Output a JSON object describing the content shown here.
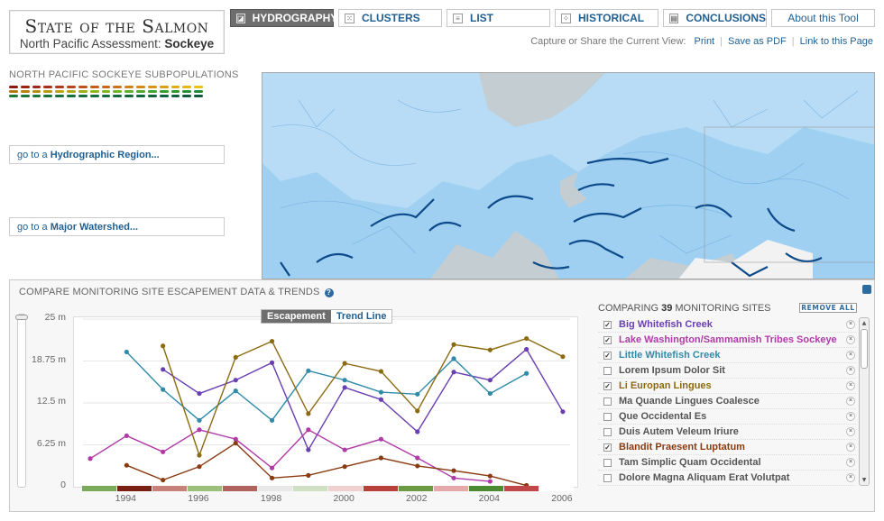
{
  "logo": {
    "title": "State of the Salmon",
    "subtitle_prefix": "North Pacific Assessment: ",
    "subtitle_species": "Sockeye"
  },
  "nav": [
    {
      "label": "HYDROGRAPHY",
      "icon": "hydrography-icon",
      "active": true
    },
    {
      "label": "CLUSTERS",
      "icon": "clusters-icon",
      "active": false
    },
    {
      "label": "LIST",
      "icon": "list-icon",
      "active": false
    },
    {
      "label": "HISTORICAL",
      "icon": "historical-icon",
      "active": false
    },
    {
      "label": "CONCLUSIONS",
      "icon": "conclusions-icon",
      "active": false
    },
    {
      "label": "About this Tool",
      "active": false
    }
  ],
  "share": {
    "prefix": "Capture or Share the Current View:",
    "print": "Print",
    "pdf": "Save as PDF",
    "link": "Link to this Page"
  },
  "left": {
    "subpop_title": "NORTH PACIFIC SOCKEYE SUBPOPULATIONS",
    "goto_region_prefix": "go to a ",
    "goto_region": "Hydrographic Region...",
    "goto_watershed_prefix": "go to a ",
    "goto_watershed": "Major Watershed..."
  },
  "panel": {
    "title": "COMPARE MONITORING SITE ESCAPEMENT DATA & TRENDS",
    "help": "?",
    "toggle_on": "Escapement",
    "toggle_off": "Trend Line",
    "compare_prefix": "COMPARING ",
    "compare_count": "39",
    "compare_suffix": " MONITORING SITES",
    "remove_all": "REMOVE ALL"
  },
  "sites": [
    {
      "name": "Big Whitefish Creek",
      "checked": true,
      "color": "#6a3fb2"
    },
    {
      "name": "Lake Washington/Sammamish Tribes Sockeye",
      "checked": true,
      "color": "#b03aa8"
    },
    {
      "name": "Little Whitefish Creek",
      "checked": true,
      "color": "#2f8ba8"
    },
    {
      "name": "Lorem Ipsum Dolor Sit",
      "checked": false,
      "color": "#555555"
    },
    {
      "name": "Li Europan Lingues",
      "checked": true,
      "color": "#8c6a10"
    },
    {
      "name": "Ma Quande Lingues Coalesce",
      "checked": false,
      "color": "#555555"
    },
    {
      "name": "Que Occidental Es",
      "checked": false,
      "color": "#555555"
    },
    {
      "name": "Duis Autem Veleum Iriure",
      "checked": false,
      "color": "#555555"
    },
    {
      "name": "Blandit Praesent Luptatum",
      "checked": true,
      "color": "#8a3a10"
    },
    {
      "name": "Tam Simplic Quam Occidental",
      "checked": false,
      "color": "#555555"
    },
    {
      "name": "Dolore Magna Aliquam Erat Volutpat",
      "checked": false,
      "color": "#555555"
    }
  ],
  "chart_data": {
    "type": "line",
    "x": [
      1993,
      1994,
      1995,
      1996,
      1997,
      1998,
      1999,
      2000,
      2001,
      2002,
      2003,
      2004,
      2005,
      2006
    ],
    "ylim": [
      0,
      25
    ],
    "yticks": [
      "0",
      "6.25 m",
      "12.5 m",
      "18.75 m",
      "25 m"
    ],
    "xticks": [
      "1994",
      "1996",
      "1998",
      "2000",
      "2002",
      "2004",
      "2006"
    ],
    "series": [
      {
        "name": "Big Whitefish Creek",
        "color": "#6a3fb2",
        "values": [
          null,
          null,
          17.5,
          13.9,
          15.9,
          18.5,
          5.5,
          14.8,
          13.0,
          8.2,
          17.1,
          15.9,
          20.5,
          11.2
        ]
      },
      {
        "name": "Lake Washington/Sammamish Tribes Sockeye",
        "color": "#b03aa8",
        "values": [
          4.2,
          7.6,
          5.2,
          8.5,
          7.1,
          2.8,
          8.5,
          5.5,
          7.1,
          4.3,
          1.3,
          0.8,
          null,
          null
        ]
      },
      {
        "name": "Little Whitefish Creek",
        "color": "#2f8ba8",
        "values": [
          null,
          20.1,
          14.5,
          9.9,
          14.3,
          9.9,
          17.3,
          15.9,
          14.1,
          13.8,
          19.1,
          13.9,
          16.9,
          null
        ]
      },
      {
        "name": "Li Europan Lingues",
        "color": "#8c6a10",
        "values": [
          null,
          null,
          21.0,
          4.7,
          19.3,
          21.7,
          10.9,
          18.4,
          17.2,
          11.3,
          21.2,
          20.4,
          22.1,
          19.4
        ]
      },
      {
        "name": "Blandit Praesent Luptatum",
        "color": "#8a3a10",
        "values": [
          null,
          3.2,
          1.0,
          3.0,
          6.5,
          1.3,
          1.7,
          3.0,
          4.3,
          3.1,
          2.4,
          1.6,
          0.2,
          null
        ]
      }
    ]
  }
}
